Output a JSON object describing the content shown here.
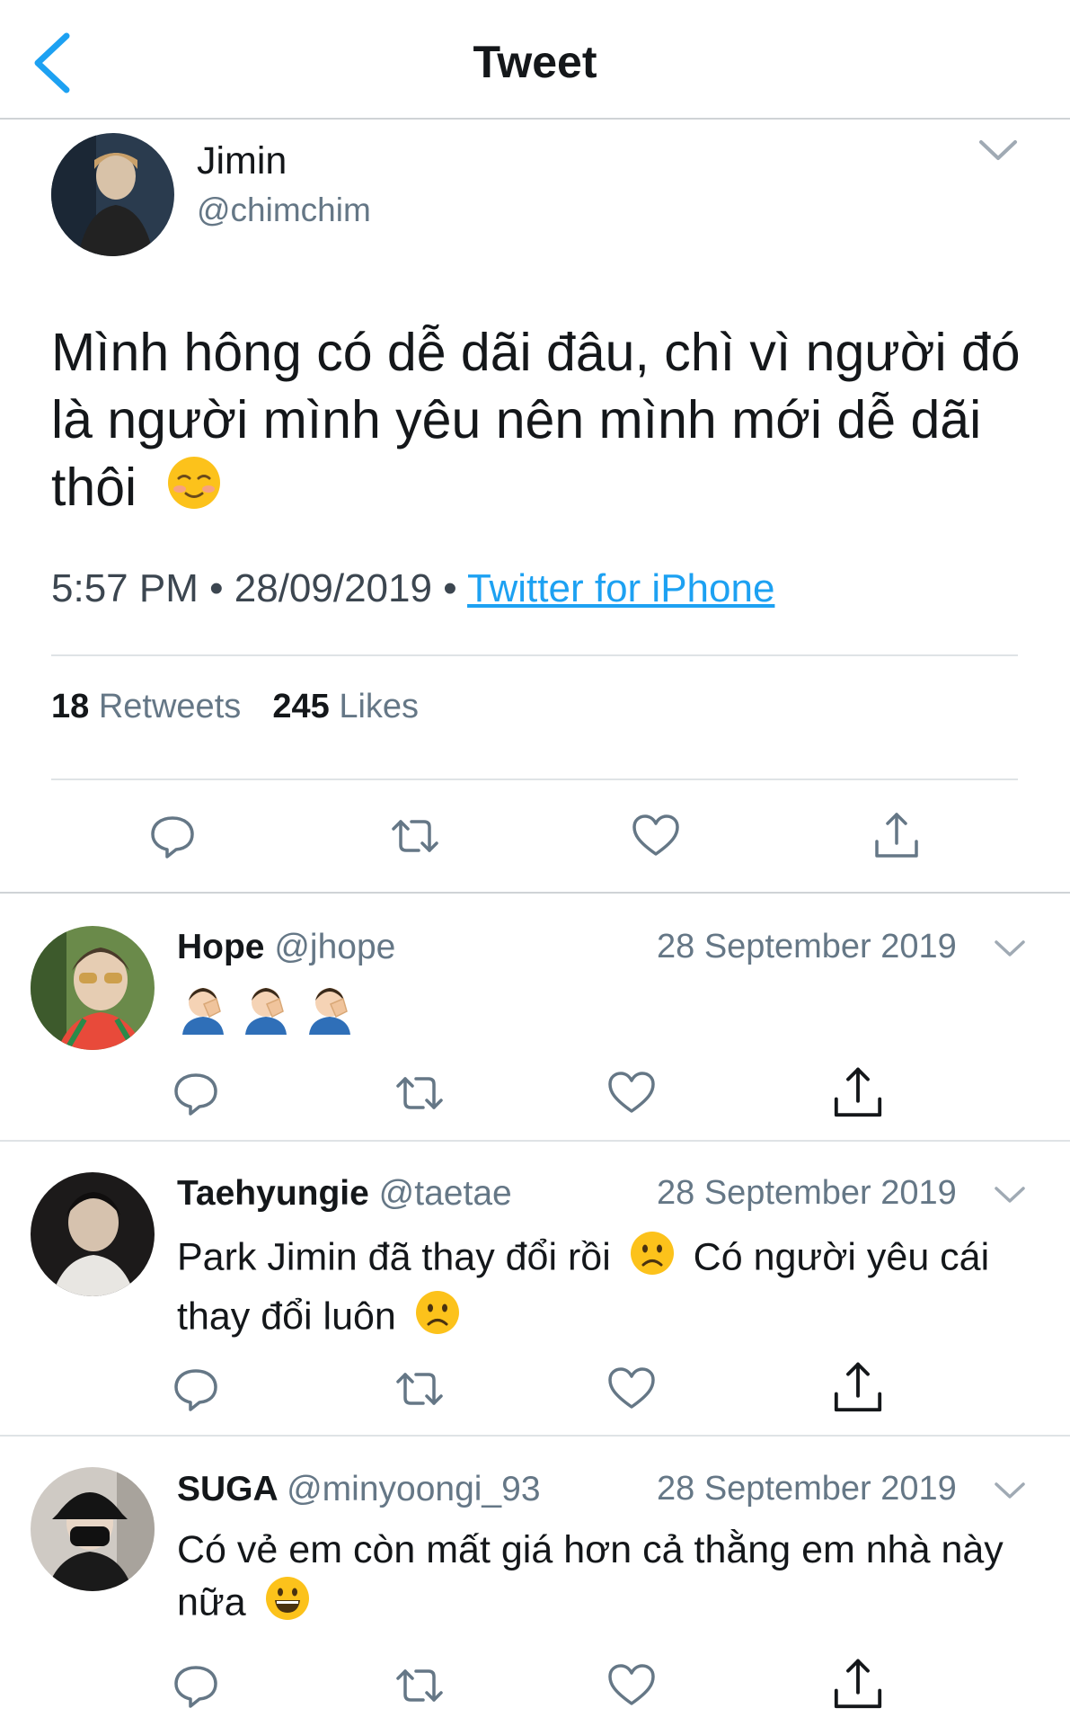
{
  "nav": {
    "title": "Tweet"
  },
  "main_tweet": {
    "name": "Jimin",
    "handle": "@chimchim",
    "text_part1": "Mình hông có dễ dãi đâu, chì vì người đó là người mình yêu nên mình mới dễ dãi thôi",
    "emoji": "smiling-face-icon",
    "time": "5:57 PM",
    "separator": "•",
    "date": "28/09/2019",
    "source": "Twitter for iPhone",
    "retweets_count": "18",
    "retweets_label": "Retweets",
    "likes_count": "245",
    "likes_label": "Likes"
  },
  "replies": [
    {
      "name": "Hope",
      "handle": "@jhope",
      "date": "28 September 2019",
      "text": "",
      "emojis": [
        "person-facepalming-icon",
        "person-facepalming-icon",
        "person-facepalming-icon"
      ]
    },
    {
      "name": "Taehyungie",
      "handle": "@taetae",
      "date": "28 September 2019",
      "text_part1": "Park Jimin đã thay đổi rồi",
      "text_part2": "Có người yêu cái thay đổi luôn"
    },
    {
      "name": "SUGA",
      "handle": "@minyoongi_93",
      "date": "28 September 2019",
      "text_part1": "Có vẻ em còn mất giá hơn cả thằng em nhà này nữa"
    }
  ],
  "colors": {
    "link": "#1da1f2",
    "secondary_text": "#657786",
    "primary_text": "#14171a",
    "icon": "#657786"
  }
}
